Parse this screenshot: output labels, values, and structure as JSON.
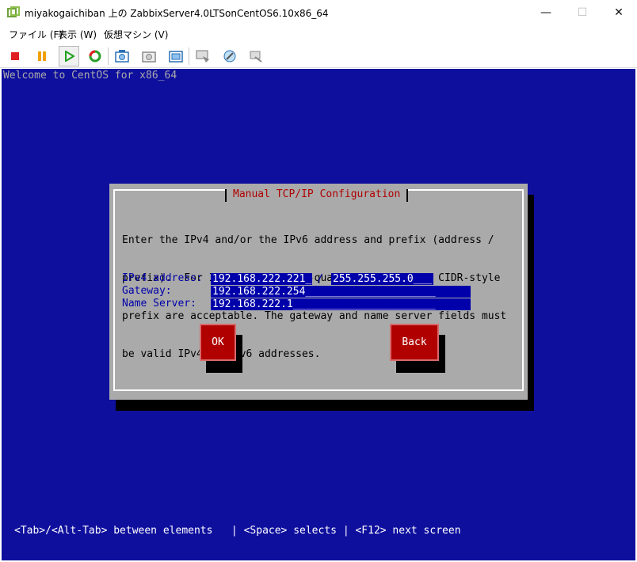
{
  "window": {
    "title": "miyakogaichiban 上の ZabbixServer4.0LTSonCentOS6.10x86_64",
    "controls": {
      "minimize": "—",
      "maximize": "☐",
      "close": "✕"
    }
  },
  "menu": [
    "ファイル (F)",
    "表示 (W)",
    "仮想マシン (V)"
  ],
  "console": {
    "welcome": "Welcome to CentOS for x86_64",
    "footer": "<Tab>/<Alt-Tab> between elements   | <Space> selects | <F12> next screen"
  },
  "dialog": {
    "title": "Manual TCP/IP Configuration",
    "text": [
      "Enter the IPv4 and/or the IPv6 address and prefix (address /",
      "prefix).  For IPv4, the dotted-quad netmask or the CIDR-style",
      "prefix are acceptable. The gateway and name server fields must",
      "be valid IPv4 or IPv6 addresses."
    ],
    "fields": {
      "ipv4_label": "IPv4 address:",
      "ipv4_value": "192.168.222.221_",
      "prefix_separator": "/",
      "prefix_value": "255.255.255.0___",
      "gateway_label": "Gateway:",
      "gateway_value": "192.168.222.254_____________________",
      "nameserver_label": "Name Server:",
      "nameserver_value": "192.168.222.1_______________________"
    },
    "ok_label": "OK",
    "back_label": "Back"
  },
  "colors": {
    "console_bg": "#0f0f9e",
    "dialog_bg": "#aaaaaa",
    "button_bg": "#b00000",
    "field_bg": "#0000aa"
  }
}
